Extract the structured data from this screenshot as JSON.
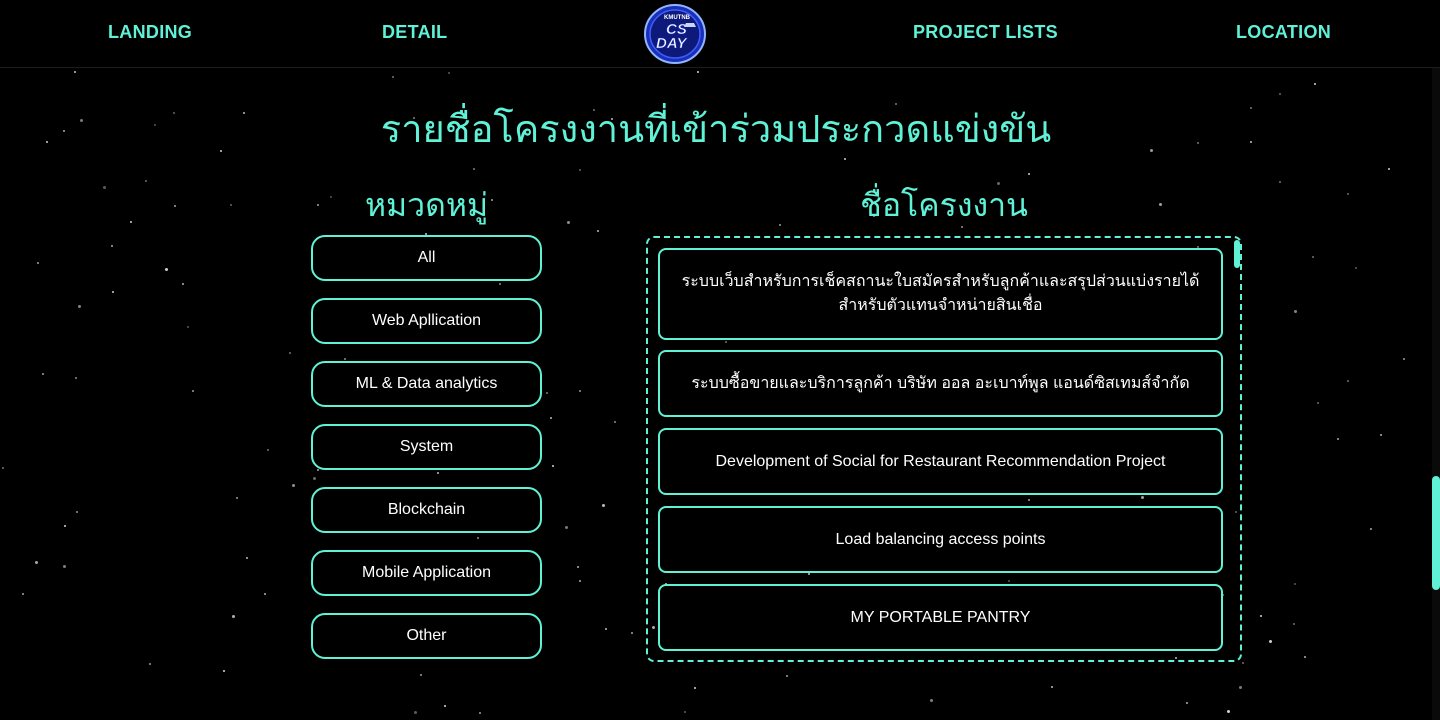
{
  "nav": {
    "landing": "LANDING",
    "detail": "DETAIL",
    "project_lists": "PROJECT LISTS",
    "location": "LOCATION"
  },
  "logo": {
    "top_text": "KMUTNB",
    "main_text_1": "CS",
    "main_text_2": "DAY"
  },
  "page_title": "รายชื่อโครงงานที่เข้าร่วมประกวดแข่งขัน",
  "categories": {
    "heading": "หมวดหมู่",
    "items": [
      "All",
      "Web Apllication",
      "ML & Data analytics",
      "System",
      "Blockchain",
      "Mobile Application",
      "Other"
    ]
  },
  "projects": {
    "heading": "ชื่อโครงงาน",
    "items": [
      "ระบบเว็บสำหรับการเช็คสถานะใบสมัครสำหรับลูกค้าและสรุปส่วนแบ่งรายได้สำหรับตัวแทนจำหน่ายสินเชื่อ",
      "ระบบซื้อขายและบริการลูกค้า บริษัท ออล อะเบาท์พูล แอนด์ซิสเทมส์จำกัด",
      "Development of Social for Restaurant Recommendation Project",
      "Load balancing access points",
      "MY PORTABLE PANTRY"
    ]
  },
  "colors": {
    "accent": "#5ff2d7",
    "background": "#000000",
    "text": "#ffffff"
  }
}
